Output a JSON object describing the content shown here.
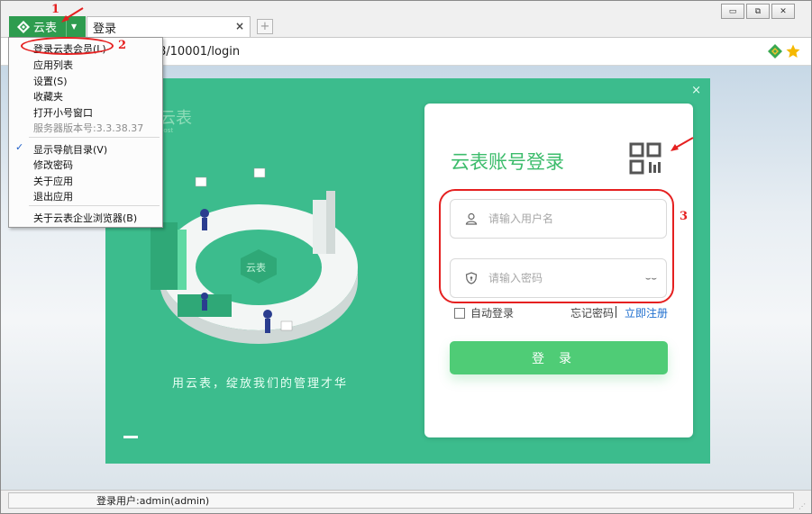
{
  "app_button": {
    "label": "云表"
  },
  "tab": {
    "title": "登录",
    "close": "×"
  },
  "newtab": {
    "label": "+"
  },
  "window_controls": {
    "minimize": "▭",
    "restore": "⧉",
    "close": "✕"
  },
  "address": {
    "url": "8/10001/login"
  },
  "menu": {
    "items": [
      {
        "label": "登录云表会员(L)"
      },
      {
        "label": "应用列表"
      },
      {
        "label": "设置(S)"
      },
      {
        "label": "收藏夹"
      },
      {
        "label": "打开小号窗口"
      },
      {
        "label": "服务器版本号:3.3.38.37"
      },
      {
        "label": "显示导航目录(V)"
      },
      {
        "label": "修改密码"
      },
      {
        "label": "关于应用"
      },
      {
        "label": "退出应用"
      },
      {
        "label": "关于云表企业浏览器(B)"
      }
    ],
    "check": "✓"
  },
  "hero": {
    "brand": "云表",
    "brand_sub": "host",
    "tagline": "用云表，绽放我们的管理才华",
    "close": "×"
  },
  "login": {
    "title": "云表账号登录",
    "username_placeholder": "请输入用户名",
    "password_placeholder": "请输入密码",
    "auto_login": "自动登录",
    "forgot": "忘记密码",
    "register": "立即注册",
    "submit": "登录"
  },
  "status": {
    "text": "登录用户:admin(admin)"
  },
  "annotations": {
    "n1": "1",
    "n2": "2",
    "n3": "3"
  },
  "colors": {
    "accent_green": "#3cbc8d",
    "button_green": "#4fcc76",
    "annotation_red": "#e52020"
  }
}
